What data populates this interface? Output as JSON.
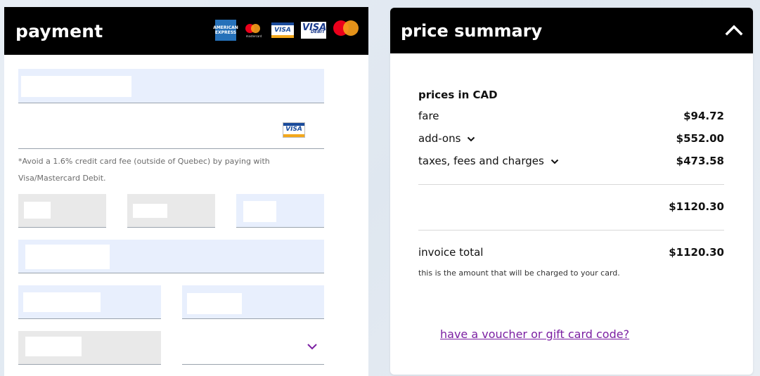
{
  "payment": {
    "title": "payment",
    "card_logos": [
      "amex-logo",
      "mastercard-logo",
      "visa-logo",
      "visa-debit-logo",
      "mastercard-debit-logo"
    ],
    "amex_text": "AMERICAN EXPRESS",
    "mastercard_small_caption": "mastercard",
    "visa_text": "VISA",
    "visa_debit_text": "VISA",
    "visa_debit_caption": "DEBIT",
    "card_number_brand": "VISA",
    "fee_note": "*Avoid a 1.6% credit card fee (outside of Quebec) by paying with Visa/Mastercard Debit."
  },
  "summary": {
    "title": "price summary",
    "currency_label": "prices in CAD",
    "lines": [
      {
        "label": "fare",
        "amount": "$94.72"
      },
      {
        "label": "add-ons",
        "amount": "$552.00"
      },
      {
        "label": "taxes, fees and charges",
        "amount": "$473.58"
      }
    ],
    "subtotal": "$1120.30",
    "invoice_label": "invoice total",
    "invoice_total": "$1120.30",
    "charge_note": "this is the amount that will be charged to your card.",
    "voucher_link": "have a voucher or gift card code?"
  },
  "colors": {
    "header_bg": "#000000",
    "field_blue": "#e8effd",
    "field_grey": "#e9e9e9",
    "link_purple": "#7b1fa2"
  }
}
